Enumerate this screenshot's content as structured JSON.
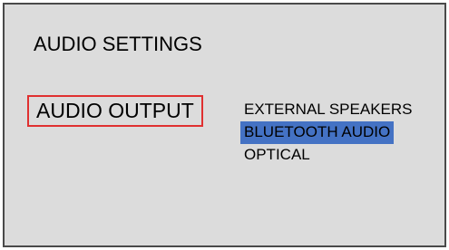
{
  "screen": {
    "title": "AUDIO SETTINGS"
  },
  "menu": {
    "label": "AUDIO OUTPUT",
    "options": [
      {
        "label": "EXTERNAL SPEAKERS",
        "selected": false
      },
      {
        "label": "BLUETOOTH AUDIO",
        "selected": true
      },
      {
        "label": "OPTICAL",
        "selected": false
      }
    ]
  },
  "colors": {
    "background": "#dcdcdc",
    "border": "#4a4a4a",
    "focus_outline": "#e03030",
    "selection_highlight": "#4472c4"
  }
}
